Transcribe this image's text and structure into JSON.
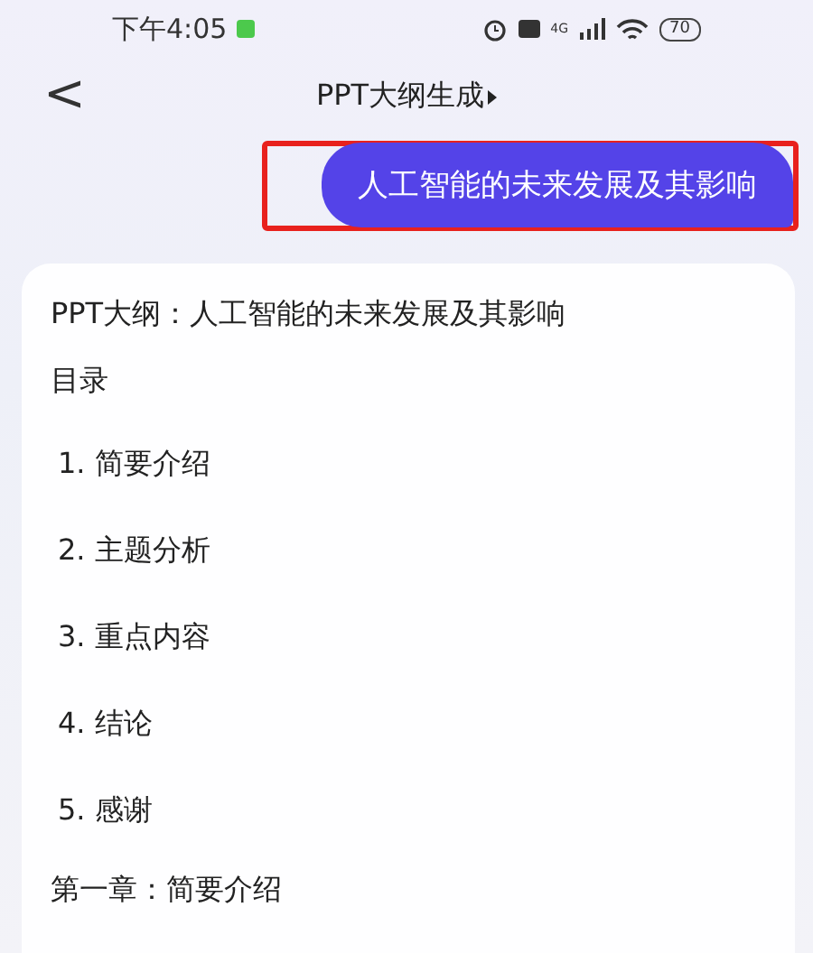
{
  "status_bar": {
    "time": "下午4:05",
    "network": "4G",
    "battery": "70"
  },
  "header": {
    "back": "<",
    "title": "PPT大纲生成"
  },
  "user_message": {
    "text": "人工智能的未来发展及其影响",
    "highlighted": true
  },
  "outline": {
    "title": "PPT大纲：人工智能的未来发展及其影响",
    "toc_label": "目录",
    "items": [
      "1. 简要介绍",
      "2. 主题分析",
      "3. 重点内容",
      "4. 结论",
      "5. 感谢"
    ],
    "chapter": "第一章：简要介绍"
  }
}
